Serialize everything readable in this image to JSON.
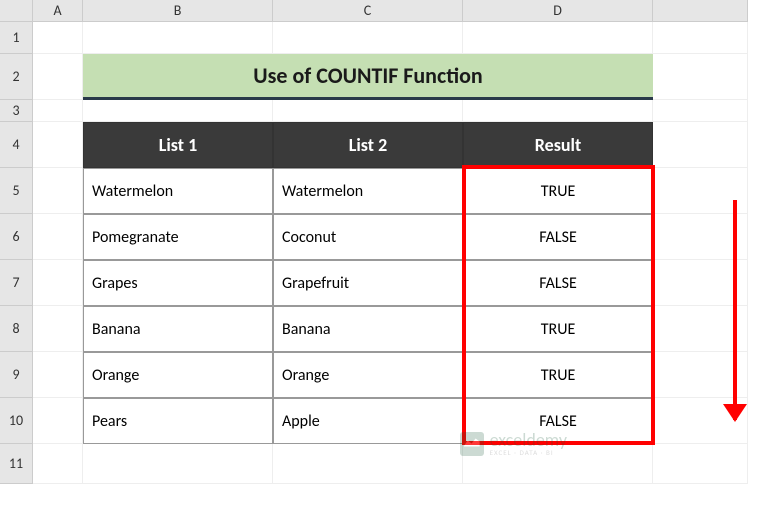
{
  "columns": [
    "A",
    "B",
    "C",
    "D"
  ],
  "rows": [
    "1",
    "2",
    "3",
    "4",
    "5",
    "6",
    "7",
    "8",
    "9",
    "10",
    "11"
  ],
  "title": "Use of COUNTIF Function",
  "headers": {
    "list1": "List 1",
    "list2": "List 2",
    "result": "Result"
  },
  "data": [
    {
      "list1": "Watermelon",
      "list2": "Watermelon",
      "result": "TRUE"
    },
    {
      "list1": "Pomegranate",
      "list2": "Coconut",
      "result": "FALSE"
    },
    {
      "list1": "Grapes",
      "list2": "Grapefruit",
      "result": "FALSE"
    },
    {
      "list1": "Banana",
      "list2": "Banana",
      "result": "TRUE"
    },
    {
      "list1": "Orange",
      "list2": "Orange",
      "result": "TRUE"
    },
    {
      "list1": "Pears",
      "list2": "Apple",
      "result": "FALSE"
    }
  ],
  "watermark": {
    "main": "exceldemy",
    "sub": "EXCEL · DATA · BI"
  }
}
